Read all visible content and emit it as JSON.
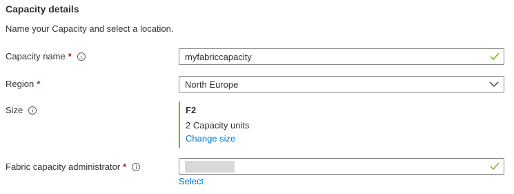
{
  "section": {
    "title": "Capacity details",
    "description": "Name your Capacity and select a location."
  },
  "capacity_name": {
    "label": "Capacity name",
    "required_marker": "*",
    "value": "myfabriccapacity",
    "valid": true
  },
  "region": {
    "label": "Region",
    "required_marker": "*",
    "selected": "North Europe"
  },
  "size": {
    "label": "Size",
    "sku": "F2",
    "units_text": "2 Capacity units",
    "change_link": "Change size"
  },
  "admin": {
    "label": "Fabric capacity administrator",
    "required_marker": "*",
    "value_redacted": true,
    "valid": true,
    "select_link": "Select"
  },
  "colors": {
    "accent_link": "#0078d4",
    "valid_check": "#6bb700",
    "required": "#a4262c",
    "size_bar": "#6bb700"
  },
  "icons": {
    "info": "info-circle-icon",
    "valid": "checkmark-icon",
    "dropdown": "chevron-down-icon"
  }
}
